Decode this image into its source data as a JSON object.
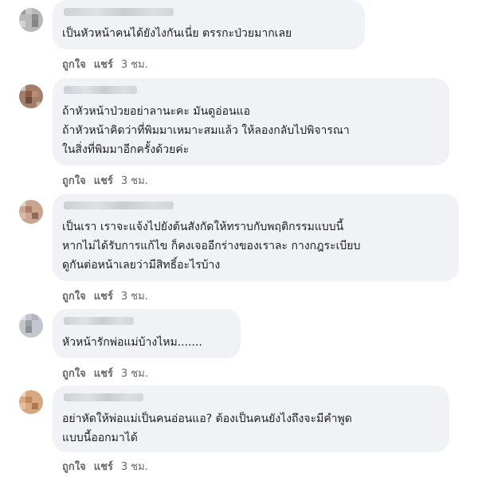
{
  "comments": [
    {
      "text": "เป็นหัวหน้าคนได้ยังไงกันเนี่ย ตรรกะป่วยมากเลย",
      "like": "ถูกใจ",
      "share": "แชร์",
      "time": "3 ชม."
    },
    {
      "text": "ถ้าหัวหน้าป่วยอย่าลานะคะ มันดูอ่อนแอ\nถ้าหัวหน้าคิดว่าที่พิมมาเหมาะสมแล้ว ให้ลองกลับไปพิจารณา\nในสิ่งที่พิมมาอีกครั้งด้วยค่ะ",
      "like": "ถูกใจ",
      "share": "แชร์",
      "time": "3 ชม."
    },
    {
      "text": "เป็นเรา เราจะแจ้งไปยังต้นสังกัดให้ทราบกับพฤติกรรมแบบนี้\nหากไม่ได้รับการแก้ไข ก็คงเจออีกร่างของเราละ กางกฎระเบียบ\nดูกันต่อหน้าเลยว่ามีสิทธิ์อะไรบ้าง",
      "like": "ถูกใจ",
      "share": "แชร์",
      "time": "3 ชม."
    },
    {
      "text": "หัวหน้ารักพ่อแม่บ้างไหม.......",
      "like": "ถูกใจ",
      "share": "แชร์",
      "time": "3 ชม."
    },
    {
      "text": "อย่าหัดให้พ่อแม่เป็นคนอ่อนแอ? ต้องเป็นคนยังไงถึงจะมีคำพูด\nแบบนี้ออกมาได้",
      "like": "ถูกใจ",
      "share": "แชร์",
      "time": "3 ชม."
    }
  ]
}
